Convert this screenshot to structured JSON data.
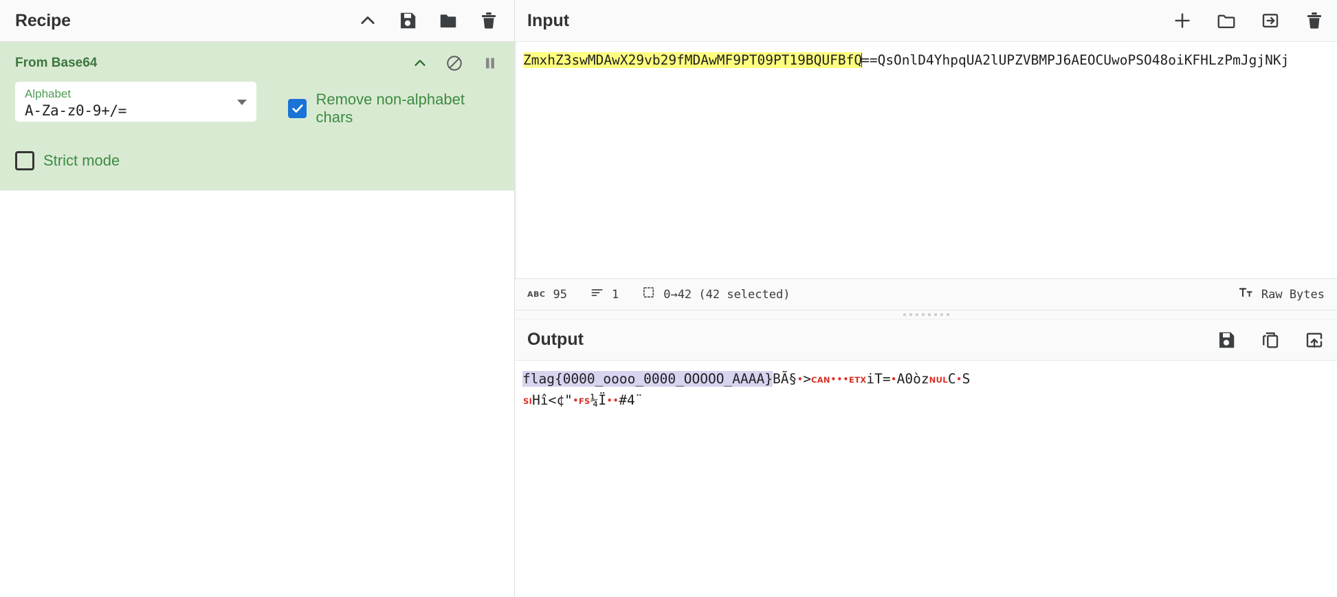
{
  "recipe": {
    "title": "Recipe",
    "title_icons": [
      {
        "name": "collapse-chevron-icon",
        "label": "collapse"
      },
      {
        "name": "save-recipe-icon",
        "label": "Save recipe"
      },
      {
        "name": "load-recipe-icon",
        "label": "Load recipe"
      },
      {
        "name": "clear-recipe-icon",
        "label": "Clear recipe"
      }
    ],
    "operation": {
      "name": "From Base64",
      "header_icons": [
        {
          "name": "op-collapse-chevron-icon",
          "label": "collapse"
        },
        {
          "name": "op-disable-icon",
          "label": "Disable operation"
        },
        {
          "name": "op-breakpoint-pause-icon",
          "label": "Set breakpoint"
        }
      ],
      "alphabet_label": "Alphabet",
      "alphabet_value": "A-Za-z0-9+/=",
      "remove_non_alphabet_label": "Remove non-alphabet chars",
      "remove_non_alphabet_checked": true,
      "strict_mode_label": "Strict mode",
      "strict_mode_checked": false
    }
  },
  "input": {
    "title": "Input",
    "title_icons": [
      {
        "name": "add-input-tab-icon",
        "label": "Add a new input tab"
      },
      {
        "name": "open-folder-icon",
        "label": "Open file as input"
      },
      {
        "name": "open-folder-as-input-icon",
        "label": "Open folder as input"
      },
      {
        "name": "clear-input-icon",
        "label": "Clear input and output"
      }
    ],
    "text_selected": "ZmxhZ3swMDAwX29vb29fMDAwMF9PT09PT19BQUFBfQ",
    "text_rest": "==QsOnlD4YhpqUA2lUPZVBMPJ6AEOCUwoPSO48oiKFHLzPmJgjNKj",
    "status": {
      "length_icon": "abc-length-icon",
      "length": "95",
      "lines_icon": "lines-count-icon",
      "lines": "1",
      "selection_icon": "selection-range-icon",
      "selection": "0→42 (42 selected)",
      "encoding_icon": "text-format-icon",
      "encoding": "Raw Bytes"
    }
  },
  "output": {
    "title": "Output",
    "title_icons": [
      {
        "name": "save-output-icon",
        "label": "Save output to file"
      },
      {
        "name": "copy-output-icon",
        "label": "Copy raw output to the clipboard"
      },
      {
        "name": "replace-input-with-output-icon",
        "label": "Replace input with output"
      }
    ],
    "line1": {
      "selected": "flag{0000_oooo_0000_OOOOO_AAAA}",
      "tail": [
        {
          "t": "text",
          "v": "BÃ§"
        },
        {
          "t": "dot"
        },
        {
          "t": "text",
          "v": ">"
        },
        {
          "t": "ctrl",
          "v": "CAN"
        },
        {
          "t": "dot"
        },
        {
          "t": "dot"
        },
        {
          "t": "dot"
        },
        {
          "t": "ctrl",
          "v": "ETX"
        },
        {
          "t": "text",
          "v": "iT="
        },
        {
          "t": "dot"
        },
        {
          "t": "text",
          "v": "A0òz"
        },
        {
          "t": "ctrl",
          "v": "NUL"
        },
        {
          "t": "text",
          "v": "C"
        },
        {
          "t": "dot"
        },
        {
          "t": "text",
          "v": "S"
        }
      ]
    },
    "line2": [
      {
        "t": "ctrl",
        "v": "SI"
      },
      {
        "t": "text",
        "v": "Hî<¢\""
      },
      {
        "t": "dot"
      },
      {
        "t": "ctrl",
        "v": "FS"
      },
      {
        "t": "text",
        "v": "¼Ï"
      },
      {
        "t": "dot"
      },
      {
        "t": "dot"
      },
      {
        "t": "text",
        "v": "#4¨"
      }
    ]
  },
  "colors": {
    "op_bg": "#d9ead3",
    "op_title": "#3c763d",
    "checkbox_on": "#1a73d6",
    "selection_highlight": "#ffff7f",
    "output_selection": "#d7d4f0",
    "control_char": "#d93025"
  }
}
